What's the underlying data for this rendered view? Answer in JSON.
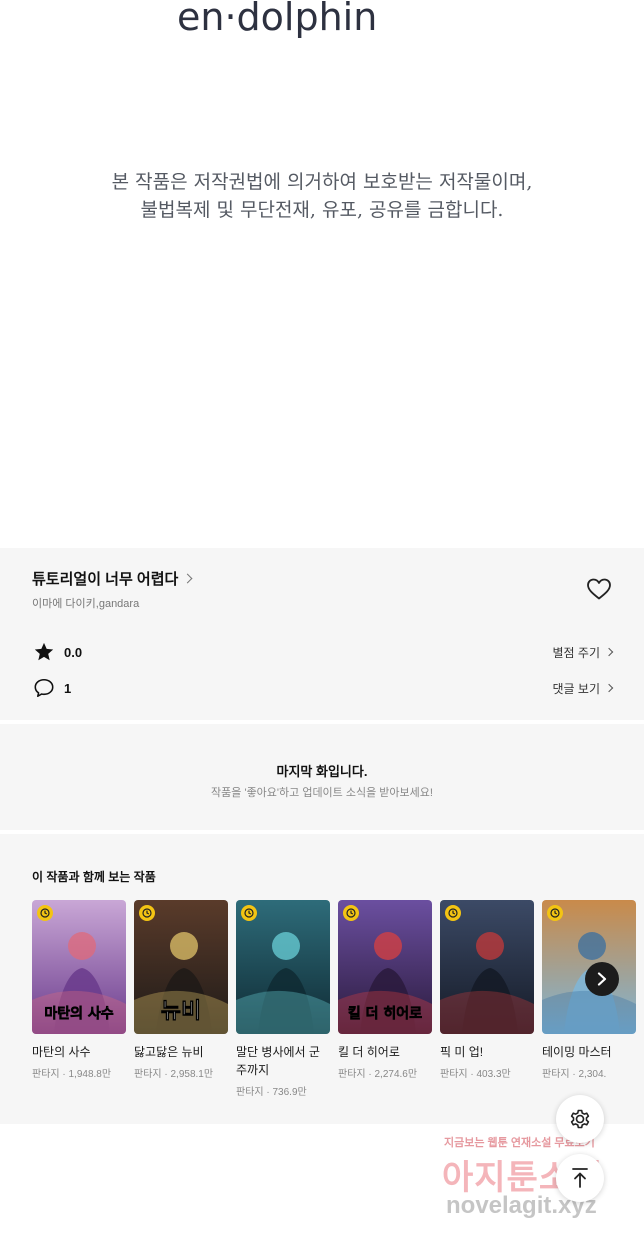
{
  "brand": {
    "logo_text": "en·dolphin"
  },
  "copyright": {
    "line1": "본 작품은 저작권법에 의거하여 보호받는 저작물이며,",
    "line2": "불법복제 및 무단전재, 유포, 공유를 금합니다."
  },
  "series": {
    "title": "튜토리얼이 너무 어렵다",
    "authors": "이마에 다이키,gandara"
  },
  "stats": {
    "rating": "0.0",
    "rating_action": "별점 주기",
    "comments": "1",
    "comments_action": "댓글 보기"
  },
  "end_notice": {
    "title": "마지막 화입니다.",
    "subtitle": "작품을 '좋아요'하고 업데이트 소식을 받아보세요!"
  },
  "recommendations": {
    "heading": "이 작품과 함께 보는 작품",
    "items": [
      {
        "title": "마탄의 사수",
        "meta": "판타지 · 1,948.8만",
        "cover_text": "마탄의 사수",
        "palette": [
          "#c9a7d6",
          "#6a3b8c",
          "#e06a7a"
        ]
      },
      {
        "title": "닳고닳은 뉴비",
        "meta": "판타지 · 2,958.1만",
        "cover_text": "뉴비",
        "palette": [
          "#5a3b2a",
          "#1e1a18",
          "#e0c36a"
        ]
      },
      {
        "title": "말단 병사에서 군주까지",
        "meta": "판타지 · 736.9만",
        "cover_text": "",
        "palette": [
          "#2e6c7a",
          "#0f2a33",
          "#6ad0d8"
        ]
      },
      {
        "title": "킬 더 히어로",
        "meta": "판타지 · 2,274.6만",
        "cover_text": "킬 더 히어로",
        "palette": [
          "#6b4fa0",
          "#2a1a3c",
          "#d94040"
        ]
      },
      {
        "title": "픽 미 업!",
        "meta": "판타지 · 403.3만",
        "cover_text": "",
        "palette": [
          "#3c4a66",
          "#141a26",
          "#c63a3a"
        ]
      },
      {
        "title": "테이밍 마스터",
        "meta": "판타지 · 2,304.",
        "cover_text": "",
        "palette": [
          "#c98a4a",
          "#7fb6d8",
          "#3a6fa0"
        ]
      }
    ]
  },
  "watermark": {
    "line1": "지금보는 웹툰 연재소설 무료보기",
    "line2": "아지툰소설",
    "line3": "novelagit.xyz"
  },
  "colors": {
    "accent_badge": "#f3c413",
    "section_bg": "#f6f6f6"
  }
}
